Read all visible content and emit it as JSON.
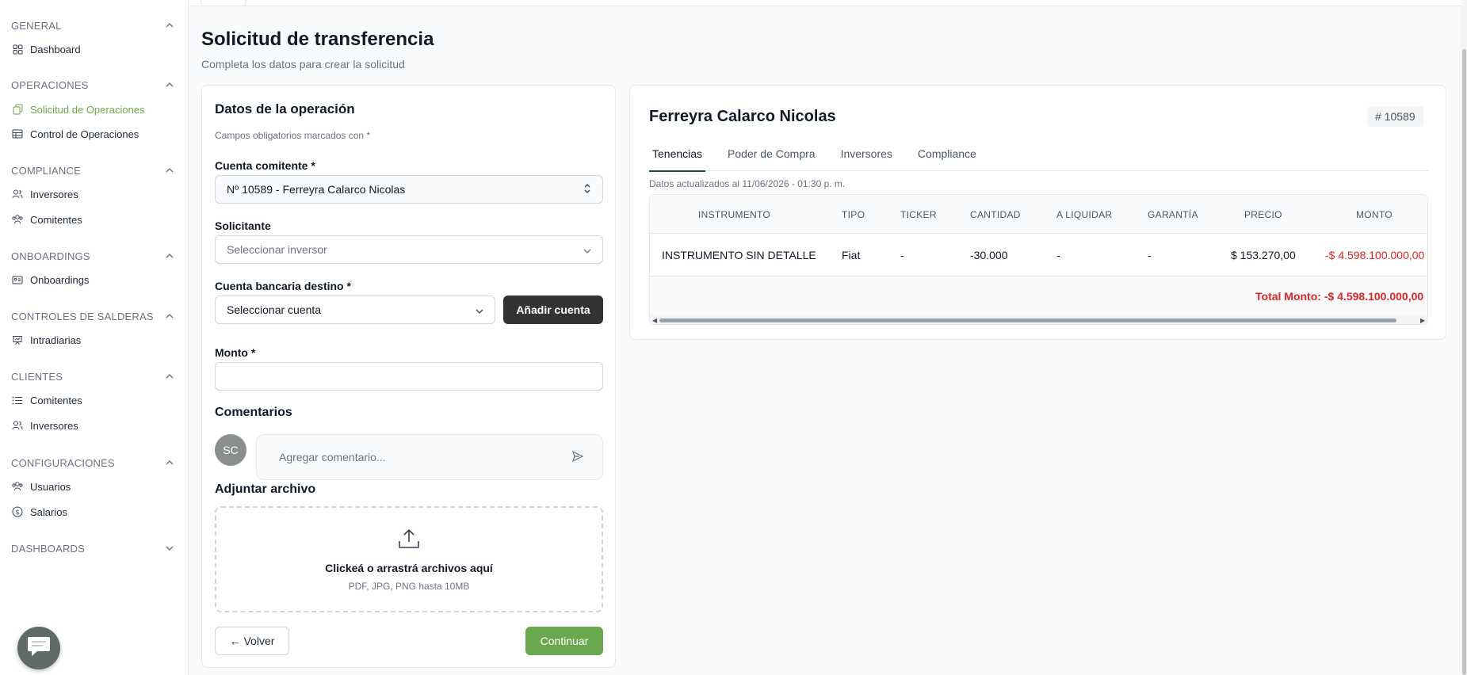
{
  "sidebar": {
    "sections": [
      {
        "title": "GENERAL",
        "expanded": true,
        "items": [
          {
            "label": "Dashboard",
            "icon": "grid-icon"
          }
        ]
      },
      {
        "title": "OPERACIONES",
        "expanded": true,
        "items": [
          {
            "label": "Solicitud de Operaciones",
            "icon": "copy-icon",
            "active": true
          },
          {
            "label": "Control de Operaciones",
            "icon": "table-icon"
          }
        ]
      },
      {
        "title": "COMPLIANCE",
        "expanded": true,
        "items": [
          {
            "label": "Inversores",
            "icon": "users-icon"
          },
          {
            "label": "Comitentes",
            "icon": "team-icon"
          }
        ]
      },
      {
        "title": "ONBOARDINGS",
        "expanded": true,
        "items": [
          {
            "label": "Onboardings",
            "icon": "id-card-icon"
          }
        ]
      },
      {
        "title": "CONTROLES DE SALDERAS",
        "expanded": true,
        "items": [
          {
            "label": "Intradiarias",
            "icon": "presentation-icon"
          }
        ]
      },
      {
        "title": "CLIENTES",
        "expanded": true,
        "items": [
          {
            "label": "Comitentes",
            "icon": "list-icon"
          },
          {
            "label": "Inversores",
            "icon": "users-icon"
          }
        ]
      },
      {
        "title": "CONFIGURACIONES",
        "expanded": true,
        "items": [
          {
            "label": "Usuarios",
            "icon": "team-icon"
          },
          {
            "label": "Salarios",
            "icon": "dollar-circle-icon"
          }
        ]
      },
      {
        "title": "DASHBOARDS",
        "expanded": false,
        "items": []
      }
    ]
  },
  "page": {
    "title": "Solicitud de transferencia",
    "subtitle": "Completa los datos para crear la solicitud"
  },
  "form": {
    "title": "Datos de la operación",
    "hint": "Campos obligatorios marcados con *",
    "cuenta_label": "Cuenta comitente *",
    "cuenta_value": "Nº 10589 - Ferreyra Calarco Nicolas",
    "solicitante_label": "Solicitante",
    "solicitante_placeholder": "Seleccionar inversor",
    "bancaria_label": "Cuenta bancaria destino *",
    "bancaria_placeholder": "Seleccionar cuenta",
    "add_account_label": "Añadir cuenta",
    "monto_label": "Monto *",
    "monto_value": "",
    "comentarios_label": "Comentarios",
    "avatar_initials": "SC",
    "comment_placeholder": "Agregar comentario...",
    "adjuntar_label": "Adjuntar archivo",
    "dropzone_title": "Clickeá o arrastrá archivos aquí",
    "dropzone_sub": "PDF, JPG, PNG hasta 10MB",
    "back_label": "← Volver",
    "continue_label": "Continuar"
  },
  "client": {
    "name": "Ferreyra Calarco Nicolas",
    "id_badge": "# 10589",
    "tabs": [
      "Tenencias",
      "Poder de Compra",
      "Inversores",
      "Compliance"
    ],
    "active_tab": "Tenencias",
    "updated_text": "Datos actualizados al 11/06/2026 - 01:30 p. m.",
    "table": {
      "headers": [
        "INSTRUMENTO",
        "TIPO",
        "TICKER",
        "CANTIDAD",
        "A LIQUIDAR",
        "GARANTÍA",
        "PRECIO",
        "MONTO"
      ],
      "rows": [
        [
          "INSTRUMENTO SIN DETALLE",
          "Fiat",
          "-",
          "-30.000",
          "-",
          "-",
          "$ 153.270,00",
          "-$ 4.598.100.000,00"
        ]
      ],
      "total_text": "Total Monto: -$ 4.598.100.000,00"
    }
  },
  "colors": {
    "accent": "#6aa84f",
    "negative": "#dc2626",
    "dark_button": "#333333",
    "tab_underline": "#1f4a3a"
  }
}
